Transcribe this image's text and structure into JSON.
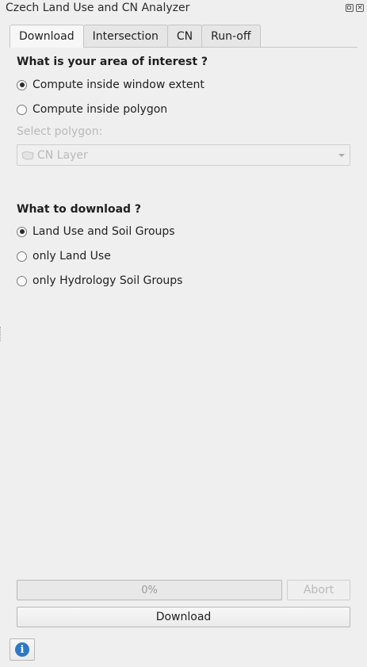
{
  "window": {
    "title": "Czech Land Use and CN Analyzer",
    "float_icon": "float-window-icon",
    "close_icon": "close-window-icon",
    "close_glyph": "×"
  },
  "tabs": [
    {
      "label": "Download",
      "active": true
    },
    {
      "label": "Intersection",
      "active": false
    },
    {
      "label": "CN",
      "active": false
    },
    {
      "label": "Run-off",
      "active": false
    }
  ],
  "area": {
    "heading": "What is your area of interest ?",
    "options": [
      {
        "label": "Compute inside window extent",
        "checked": true
      },
      {
        "label": "Compute inside polygon",
        "checked": false
      }
    ],
    "select_label": "Select polygon:",
    "select_value": "CN Layer",
    "select_icon": "polygon-layer-icon"
  },
  "download": {
    "heading": "What to download ?",
    "options": [
      {
        "label": "Land Use and Soil Groups",
        "checked": true
      },
      {
        "label": "only Land Use",
        "checked": false
      },
      {
        "label": "only Hydrology Soil Groups",
        "checked": false
      }
    ]
  },
  "footer": {
    "progress_text": "0%",
    "progress_value": 0,
    "abort_label": "Abort",
    "download_label": "Download",
    "info_icon": "info-icon",
    "info_glyph": "i"
  },
  "colors": {
    "background": "#efefef",
    "info_accent": "#2f78c4"
  }
}
